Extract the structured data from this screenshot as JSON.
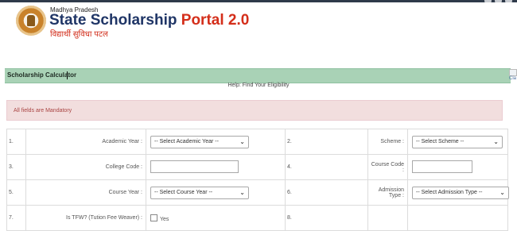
{
  "header": {
    "state": "Madhya Pradesh",
    "portal_name": "State Scholarship",
    "version": "Portal 2.0",
    "hindi_tagline": "विद्यार्थी सुविधा पटल",
    "colors": {
      "title": "#1f3566",
      "version": "#d42e1a"
    }
  },
  "calculator": {
    "title": "Scholarship Calculator",
    "image_alt": "Cla",
    "help_text": "Help: Find Your Eligibility",
    "mandatory_notice": "All fields are Mandatory",
    "bar_color": "#a9d2b6"
  },
  "form": {
    "rows": [
      {
        "left": {
          "num": "1.",
          "label": "Academic Year :",
          "value": "-- Select Academic Year --",
          "type": "select"
        },
        "right": {
          "num": "2.",
          "label": "Scheme :",
          "value": "-- Select Scheme --",
          "type": "select"
        }
      },
      {
        "left": {
          "num": "3.",
          "label": "College Code :",
          "value": "",
          "type": "input"
        },
        "right": {
          "num": "4.",
          "label": "Course Code :",
          "value": "",
          "type": "input"
        }
      },
      {
        "left": {
          "num": "5.",
          "label": "Course Year :",
          "value": "-- Select Course Year --",
          "type": "select"
        },
        "right": {
          "num": "6.",
          "label": "Admission Type :",
          "value": "-- Select Admission Type --",
          "type": "select"
        }
      },
      {
        "left": {
          "num": "7.",
          "label": "Is TFW? (Tution Fee Weaver) :",
          "value": "Yes",
          "type": "checkbox"
        },
        "right": {
          "num": "8.",
          "label": "",
          "value": "",
          "type": "empty"
        }
      }
    ]
  }
}
